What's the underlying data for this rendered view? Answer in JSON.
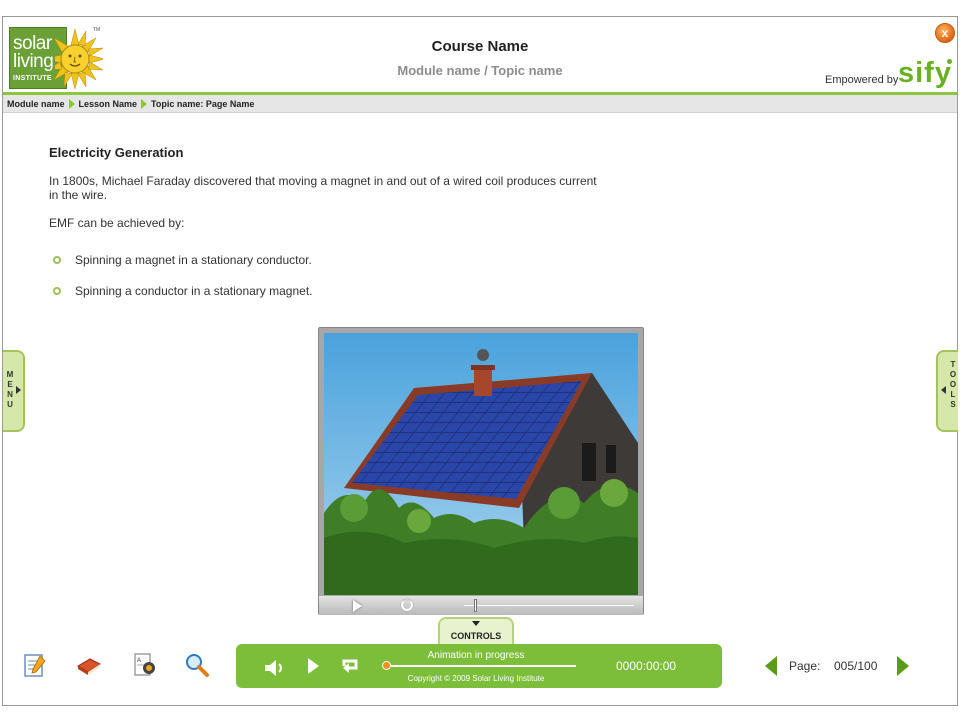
{
  "header": {
    "logo": {
      "line1": "solar",
      "line2": "living",
      "line3": "INSTITUTE",
      "tm": "TM"
    },
    "course_name": "Course Name",
    "module_topic": "Module name / Topic name",
    "empowered_by": "Empowered by",
    "brand": "sify",
    "close_glyph": "x"
  },
  "breadcrumb": {
    "items": [
      "Module name",
      "Lesson Name",
      "Topic name: Page Name"
    ]
  },
  "content": {
    "heading": "Electricity Generation",
    "paragraph": "In 1800s, Michael Faraday discovered that moving a magnet in and out of a wired coil produces current in the wire.",
    "lead": "EMF can be achieved by:",
    "bullets": [
      "Spinning a magnet in a stationary conductor.",
      "Spinning a conductor in a stationary magnet."
    ]
  },
  "media_player": {
    "icons": [
      "play-icon",
      "replay-icon"
    ],
    "seek_position": 0.06
  },
  "side_tabs": {
    "menu": [
      "M",
      "E",
      "N",
      "U"
    ],
    "tools": [
      "T",
      "O",
      "O",
      "L",
      "S"
    ]
  },
  "controls_tab": {
    "label": "CONTROLS"
  },
  "bottom_tools": {
    "icons": [
      "notepad-icon",
      "book-icon",
      "glossary-icon",
      "search-icon"
    ]
  },
  "control_bar": {
    "status": "Animation in progress",
    "copyright": "Copyright © 2009 Solar Living Institute",
    "time": "0000:00:00",
    "progress": 0.0,
    "icons": [
      "speaker-icon",
      "play-icon",
      "loop-icon"
    ]
  },
  "pagination": {
    "label": "Page:",
    "value": "005/100"
  },
  "colors": {
    "accent_green": "#8cc63f",
    "control_bar": "#7cbd3a",
    "sify_green": "#6ab023",
    "close_orange": "#e0681a"
  }
}
